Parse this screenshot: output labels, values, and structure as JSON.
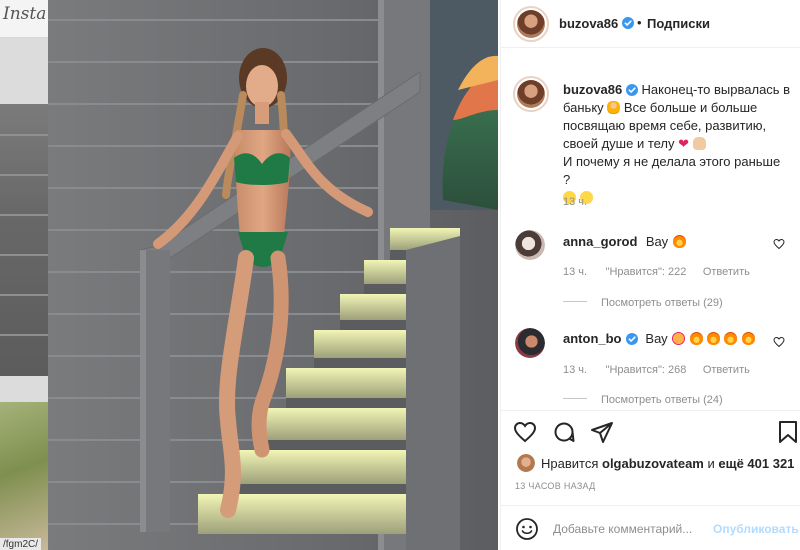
{
  "background_page": {
    "logo_text": "Insta",
    "url_text": "/fgm2C/"
  },
  "post": {
    "author": "buzova86",
    "follow_label": "Подписки",
    "caption_lines": [
      "Наконец-то вырвалась в",
      "баньку",
      "Все больше и больше",
      "посвящаю время себе, развитию,",
      "своей душе и телу",
      "И почему я не делала этого раньше ?"
    ],
    "caption_time": "13 ч.",
    "likes_prefix": "Нравится",
    "likes_user": "olgabuzovateam",
    "likes_middle": "и",
    "likes_count": "ещё 401 321",
    "timestamp": "13 ЧАСОВ НАЗАД",
    "comment_placeholder": "Добавьте комментарий...",
    "publish_label": "Опубликовать"
  },
  "comments": [
    {
      "username": "anna_gorod",
      "text": "Вау",
      "time": "13 ч.",
      "likes": "\"Нравится\": 222",
      "reply_label": "Ответить",
      "view_replies": "Посмотреть ответы (29)",
      "verified": false
    },
    {
      "username": "anton_bo",
      "text": "Вау",
      "time": "13 ч.",
      "likes": "\"Нравится\": 268",
      "reply_label": "Ответить",
      "view_replies": "Посмотреть ответы (24)",
      "verified": true
    }
  ],
  "icons": {
    "verified": "verified-badge-icon",
    "like": "heart-icon",
    "comment": "comment-bubble-icon",
    "share": "paper-plane-icon",
    "save": "bookmark-icon",
    "emoji": "smiley-icon"
  },
  "colors": {
    "verified_blue": "#3897f0",
    "text": "#262626",
    "muted": "#8e8e8e",
    "publish_disabled": "#b3dbff"
  }
}
